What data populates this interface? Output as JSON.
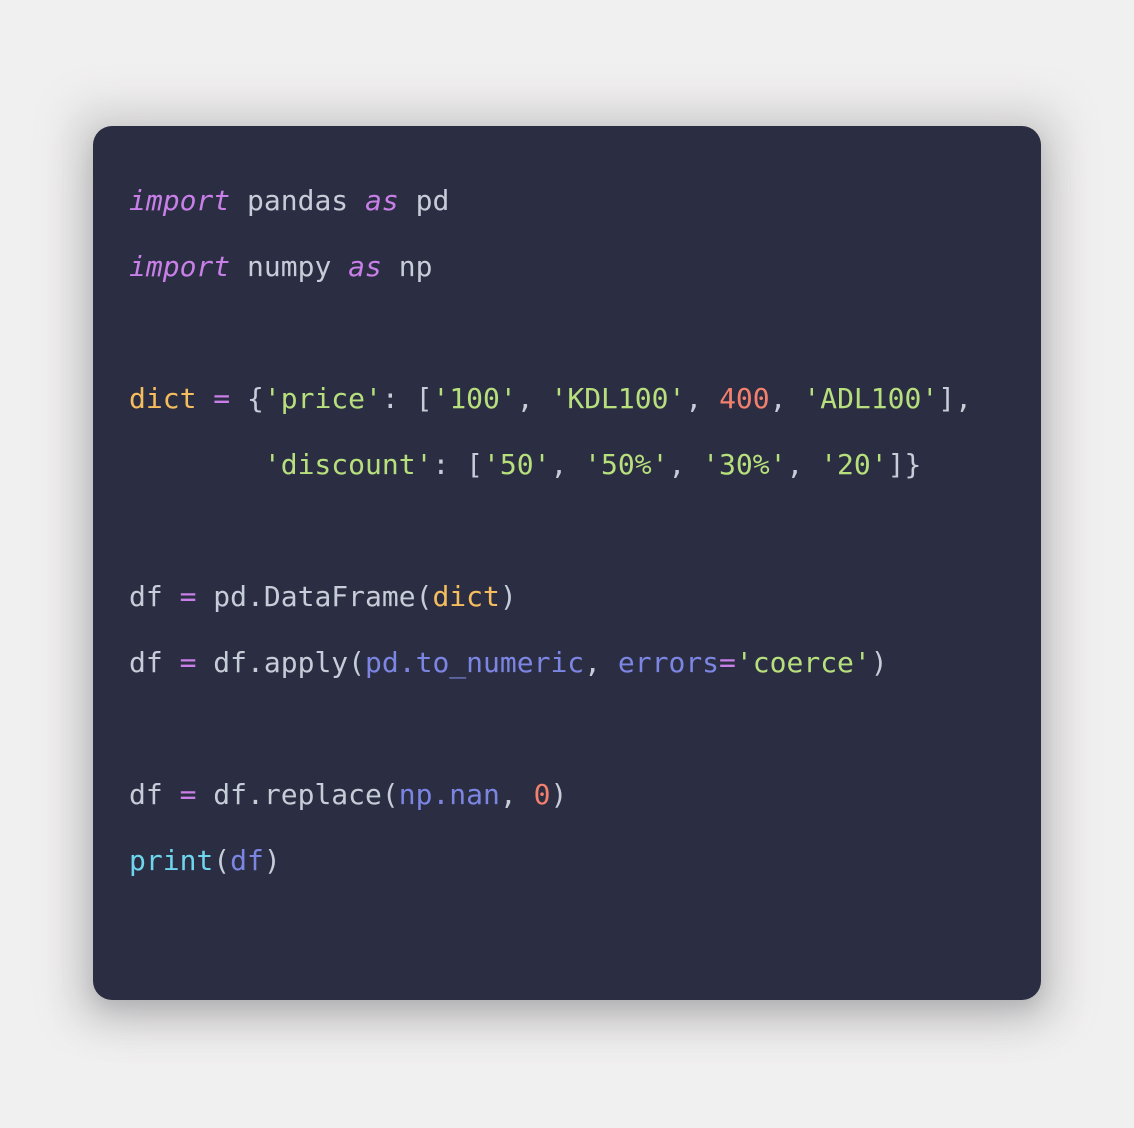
{
  "card": {
    "background_color": "#2b2e42",
    "page_background_color": "#f1f0f0",
    "corner_radius": "19px"
  },
  "theme": {
    "keyword": "#c87fe8",
    "plain": "#c6ccd8",
    "builtin": "#f6bd5e",
    "operator": "#c87fe8",
    "punctuation": "#c6ccd8",
    "string": "#b7e07d",
    "number": "#f3806c",
    "identifier": "#7c86e2",
    "function": "#6fd5ec"
  },
  "code": {
    "language": "python",
    "plain_text": "import pandas as pd\nimport numpy as np\n\ndict = {'price': ['100', 'KDL100', 400, 'ADL100'],\n        'discount': ['50', '50%', '30%', '20']}\n\ndf = pd.DataFrame(dict)\ndf = df.apply(pd.to_numeric, errors='coerce')\n\ndf = df.replace(np.nan, 0)\nprint(df)",
    "lines": [
      {
        "index": 1,
        "text": "import pandas as pd",
        "tokens": [
          {
            "t": "import",
            "k": "keyword"
          },
          {
            "t": " ",
            "k": "plain"
          },
          {
            "t": "pandas",
            "k": "plain"
          },
          {
            "t": " ",
            "k": "plain"
          },
          {
            "t": "as",
            "k": "keyword"
          },
          {
            "t": " ",
            "k": "plain"
          },
          {
            "t": "pd",
            "k": "plain"
          }
        ]
      },
      {
        "index": 2,
        "text": "import numpy as np",
        "tokens": [
          {
            "t": "import",
            "k": "keyword"
          },
          {
            "t": " ",
            "k": "plain"
          },
          {
            "t": "numpy",
            "k": "plain"
          },
          {
            "t": " ",
            "k": "plain"
          },
          {
            "t": "as",
            "k": "keyword"
          },
          {
            "t": " ",
            "k": "plain"
          },
          {
            "t": "np",
            "k": "plain"
          }
        ]
      },
      {
        "index": 3,
        "text": "",
        "tokens": []
      },
      {
        "index": 4,
        "text": "dict = {'price': ['100', 'KDL100', 400, 'ADL100'],",
        "tokens": [
          {
            "t": "dict",
            "k": "builtin"
          },
          {
            "t": " ",
            "k": "plain"
          },
          {
            "t": "=",
            "k": "operator"
          },
          {
            "t": " ",
            "k": "plain"
          },
          {
            "t": "{",
            "k": "punct"
          },
          {
            "t": "'price'",
            "k": "string"
          },
          {
            "t": ": ",
            "k": "punct"
          },
          {
            "t": "[",
            "k": "punct"
          },
          {
            "t": "'100'",
            "k": "string"
          },
          {
            "t": ", ",
            "k": "punct"
          },
          {
            "t": "'KDL100'",
            "k": "string"
          },
          {
            "t": ", ",
            "k": "punct"
          },
          {
            "t": "400",
            "k": "number"
          },
          {
            "t": ", ",
            "k": "punct"
          },
          {
            "t": "'ADL100'",
            "k": "string"
          },
          {
            "t": "],",
            "k": "punct"
          }
        ]
      },
      {
        "index": 5,
        "text": "        'discount': ['50', '50%', '30%', '20']}",
        "tokens": [
          {
            "t": "        ",
            "k": "plain"
          },
          {
            "t": "'discount'",
            "k": "string"
          },
          {
            "t": ": ",
            "k": "punct"
          },
          {
            "t": "[",
            "k": "punct"
          },
          {
            "t": "'50'",
            "k": "string"
          },
          {
            "t": ", ",
            "k": "punct"
          },
          {
            "t": "'50%'",
            "k": "string"
          },
          {
            "t": ", ",
            "k": "punct"
          },
          {
            "t": "'30%'",
            "k": "string"
          },
          {
            "t": ", ",
            "k": "punct"
          },
          {
            "t": "'20'",
            "k": "string"
          },
          {
            "t": "]}",
            "k": "punct"
          }
        ]
      },
      {
        "index": 6,
        "text": "",
        "tokens": []
      },
      {
        "index": 7,
        "text": "df = pd.DataFrame(dict)",
        "tokens": [
          {
            "t": "df",
            "k": "plain"
          },
          {
            "t": " ",
            "k": "plain"
          },
          {
            "t": "=",
            "k": "operator"
          },
          {
            "t": " ",
            "k": "plain"
          },
          {
            "t": "pd.DataFrame",
            "k": "plain"
          },
          {
            "t": "(",
            "k": "punct"
          },
          {
            "t": "dict",
            "k": "builtin"
          },
          {
            "t": ")",
            "k": "punct"
          }
        ]
      },
      {
        "index": 8,
        "text": "df = df.apply(pd.to_numeric, errors='coerce')",
        "tokens": [
          {
            "t": "df",
            "k": "plain"
          },
          {
            "t": " ",
            "k": "plain"
          },
          {
            "t": "=",
            "k": "operator"
          },
          {
            "t": " ",
            "k": "plain"
          },
          {
            "t": "df.apply",
            "k": "plain"
          },
          {
            "t": "(",
            "k": "punct"
          },
          {
            "t": "pd.to_numeric",
            "k": "ident"
          },
          {
            "t": ", ",
            "k": "punct"
          },
          {
            "t": "errors",
            "k": "ident"
          },
          {
            "t": "=",
            "k": "operator"
          },
          {
            "t": "'coerce'",
            "k": "string"
          },
          {
            "t": ")",
            "k": "punct"
          }
        ]
      },
      {
        "index": 9,
        "text": "",
        "tokens": []
      },
      {
        "index": 10,
        "text": "df = df.replace(np.nan, 0)",
        "tokens": [
          {
            "t": "df",
            "k": "plain"
          },
          {
            "t": " ",
            "k": "plain"
          },
          {
            "t": "=",
            "k": "operator"
          },
          {
            "t": " ",
            "k": "plain"
          },
          {
            "t": "df.replace",
            "k": "plain"
          },
          {
            "t": "(",
            "k": "punct"
          },
          {
            "t": "np.nan",
            "k": "ident"
          },
          {
            "t": ", ",
            "k": "punct"
          },
          {
            "t": "0",
            "k": "number"
          },
          {
            "t": ")",
            "k": "punct"
          }
        ]
      },
      {
        "index": 11,
        "text": "print(df)",
        "tokens": [
          {
            "t": "print",
            "k": "func"
          },
          {
            "t": "(",
            "k": "punct"
          },
          {
            "t": "df",
            "k": "ident"
          },
          {
            "t": ")",
            "k": "punct"
          }
        ]
      }
    ]
  }
}
